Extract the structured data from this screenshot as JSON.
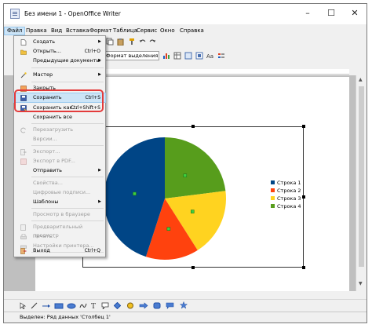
{
  "window": {
    "title": "Без имени 1 - OpenOffice Writer"
  },
  "menubar": [
    "Файл",
    "Правка",
    "Вид",
    "Вставка",
    "Формат",
    "Таблица",
    "Сервис",
    "Окно",
    "Справка"
  ],
  "toolbar": {
    "style_box": "Формат выделения"
  },
  "file_menu": [
    {
      "label": "Создать",
      "shortcut": "",
      "submenu": true,
      "disabled": false,
      "icon": "new-document-icon"
    },
    {
      "label": "Открыть...",
      "shortcut": "Ctrl+O",
      "submenu": false,
      "disabled": false,
      "icon": "open-folder-icon"
    },
    {
      "label": "Предыдущие документы",
      "shortcut": "",
      "submenu": true,
      "disabled": false,
      "icon": ""
    },
    {
      "label": "Мастер",
      "shortcut": "",
      "submenu": true,
      "disabled": false,
      "icon": "wizard-icon"
    },
    {
      "label": "Закрыть",
      "shortcut": "",
      "submenu": false,
      "disabled": false,
      "icon": "close-document-icon"
    },
    {
      "label": "Сохранить",
      "shortcut": "Ctrl+S",
      "submenu": false,
      "disabled": false,
      "icon": "save-icon",
      "highlighted": true
    },
    {
      "label": "Сохранить как...",
      "shortcut": "Ctrl+Shift+S",
      "submenu": false,
      "disabled": false,
      "icon": "save-as-icon",
      "highlighted": true
    },
    {
      "label": "Сохранить все",
      "shortcut": "",
      "submenu": false,
      "disabled": false,
      "icon": ""
    },
    {
      "label": "Перезагрузить",
      "shortcut": "",
      "submenu": false,
      "disabled": true,
      "icon": "reload-icon"
    },
    {
      "label": "Версии...",
      "shortcut": "",
      "submenu": false,
      "disabled": true,
      "icon": ""
    },
    {
      "label": "Экспорт...",
      "shortcut": "",
      "submenu": false,
      "disabled": true,
      "icon": "export-icon"
    },
    {
      "label": "Экспорт в PDF...",
      "shortcut": "",
      "submenu": false,
      "disabled": true,
      "icon": "export-pdf-icon"
    },
    {
      "label": "Отправить",
      "shortcut": "",
      "submenu": true,
      "disabled": false,
      "icon": ""
    },
    {
      "label": "Свойства...",
      "shortcut": "",
      "submenu": false,
      "disabled": true,
      "icon": ""
    },
    {
      "label": "Цифровые подписи...",
      "shortcut": "",
      "submenu": false,
      "disabled": true,
      "icon": ""
    },
    {
      "label": "Шаблоны",
      "shortcut": "",
      "submenu": true,
      "disabled": false,
      "icon": ""
    },
    {
      "label": "Просмотр в браузере",
      "shortcut": "",
      "submenu": false,
      "disabled": true,
      "icon": ""
    },
    {
      "label": "Предварительный просмотр",
      "shortcut": "",
      "submenu": false,
      "disabled": true,
      "icon": "print-preview-icon"
    },
    {
      "label": "Печать...",
      "shortcut": "",
      "submenu": false,
      "disabled": true,
      "icon": "print-icon"
    },
    {
      "label": "Настройки принтера...",
      "shortcut": "",
      "submenu": false,
      "disabled": true,
      "icon": "printer-settings-icon"
    },
    {
      "label": "Выход",
      "shortcut": "Ctrl+Q",
      "submenu": false,
      "disabled": false,
      "icon": "exit-icon"
    }
  ],
  "chart_data": {
    "type": "pie",
    "categories": [
      "Строка 1",
      "Строка 2",
      "Строка 3",
      "Строка 4"
    ],
    "values": [
      45,
      14,
      18,
      23
    ],
    "colors": [
      "#004586",
      "#ff420e",
      "#ffd320",
      "#579d1c"
    ],
    "legend_position": "right"
  },
  "statusbar": {
    "text": "Выделен: Ряд данных 'Столбец 1'"
  },
  "colors": {
    "highlight_ring": "#e33b3b",
    "menu_highlight": "#cce4f7"
  }
}
